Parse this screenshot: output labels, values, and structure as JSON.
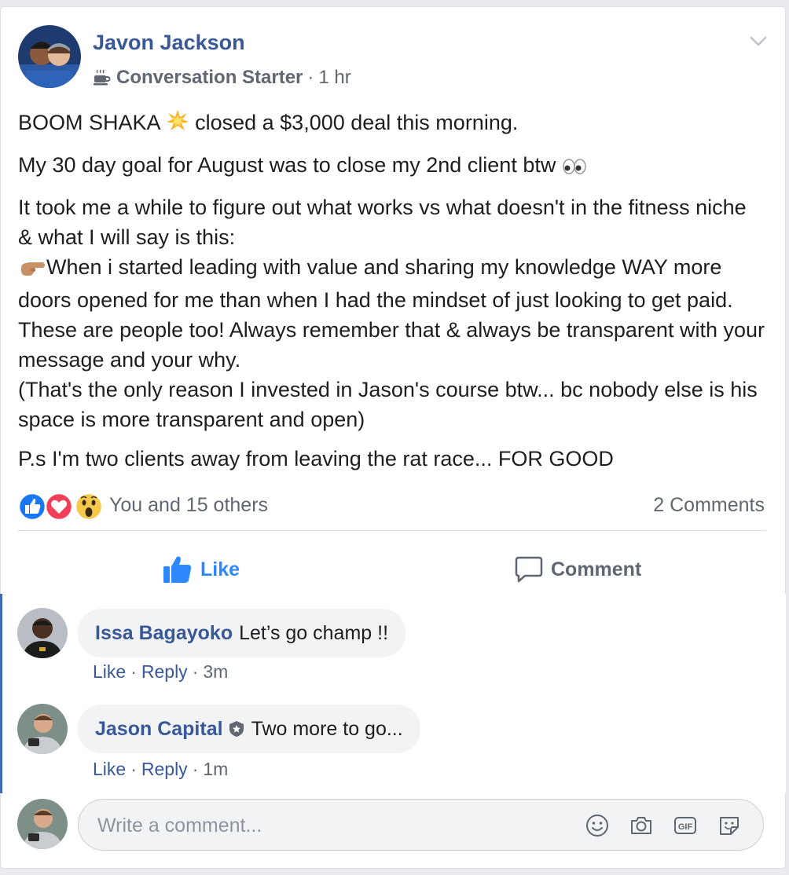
{
  "post": {
    "author": "Javon Jackson",
    "badge_label": "Conversation Starter",
    "separator": "·",
    "time": "1 hr",
    "paragraphs": {
      "p1a": "BOOM SHAKA",
      "p1b": "closed a $3,000 deal this morning.",
      "p2": "My 30 day goal for August was to close my 2nd client btw",
      "p3a": "It took me a while to figure out what works vs what doesn't in the fitness niche & what I will say is this:",
      "p3b": "When i started leading with value and sharing my knowledge WAY more doors opened for me than when I had the mindset of just looking to get paid. These are people too! Always remember that & always be transparent with your message and your why.",
      "p3c": "(That's the only reason I invested in Jason's course btw... bc nobody else is his space is more transparent and open)",
      "p4": "P.s I'm two clients away from leaving the rat race... FOR GOOD"
    },
    "reactions_text": "You and 15 others",
    "comments_count": "2 Comments",
    "actions": {
      "like": "Like",
      "comment": "Comment"
    }
  },
  "comments": [
    {
      "name": "Issa Bagayoko",
      "text": "Let’s go champ !!",
      "like": "Like",
      "reply": "Reply",
      "time": "3m",
      "sep": "·"
    },
    {
      "name": "Jason Capital",
      "text": "Two more to go...",
      "like": "Like",
      "reply": "Reply",
      "time": "1m",
      "sep": "·"
    }
  ],
  "compose": {
    "placeholder": "Write a comment..."
  },
  "icons": {
    "menu": "chevron-down-icon",
    "badge": "coffee-cup-icon",
    "reactions": [
      "like-reaction-icon",
      "love-reaction-icon",
      "wow-reaction-icon"
    ],
    "composer": [
      "emoji-icon",
      "camera-icon",
      "gif-icon",
      "sticker-icon"
    ]
  },
  "colors": {
    "link": "#385898",
    "accent": "#4267b2",
    "like_active": "#2d88ff",
    "secondary_text": "#606770"
  }
}
